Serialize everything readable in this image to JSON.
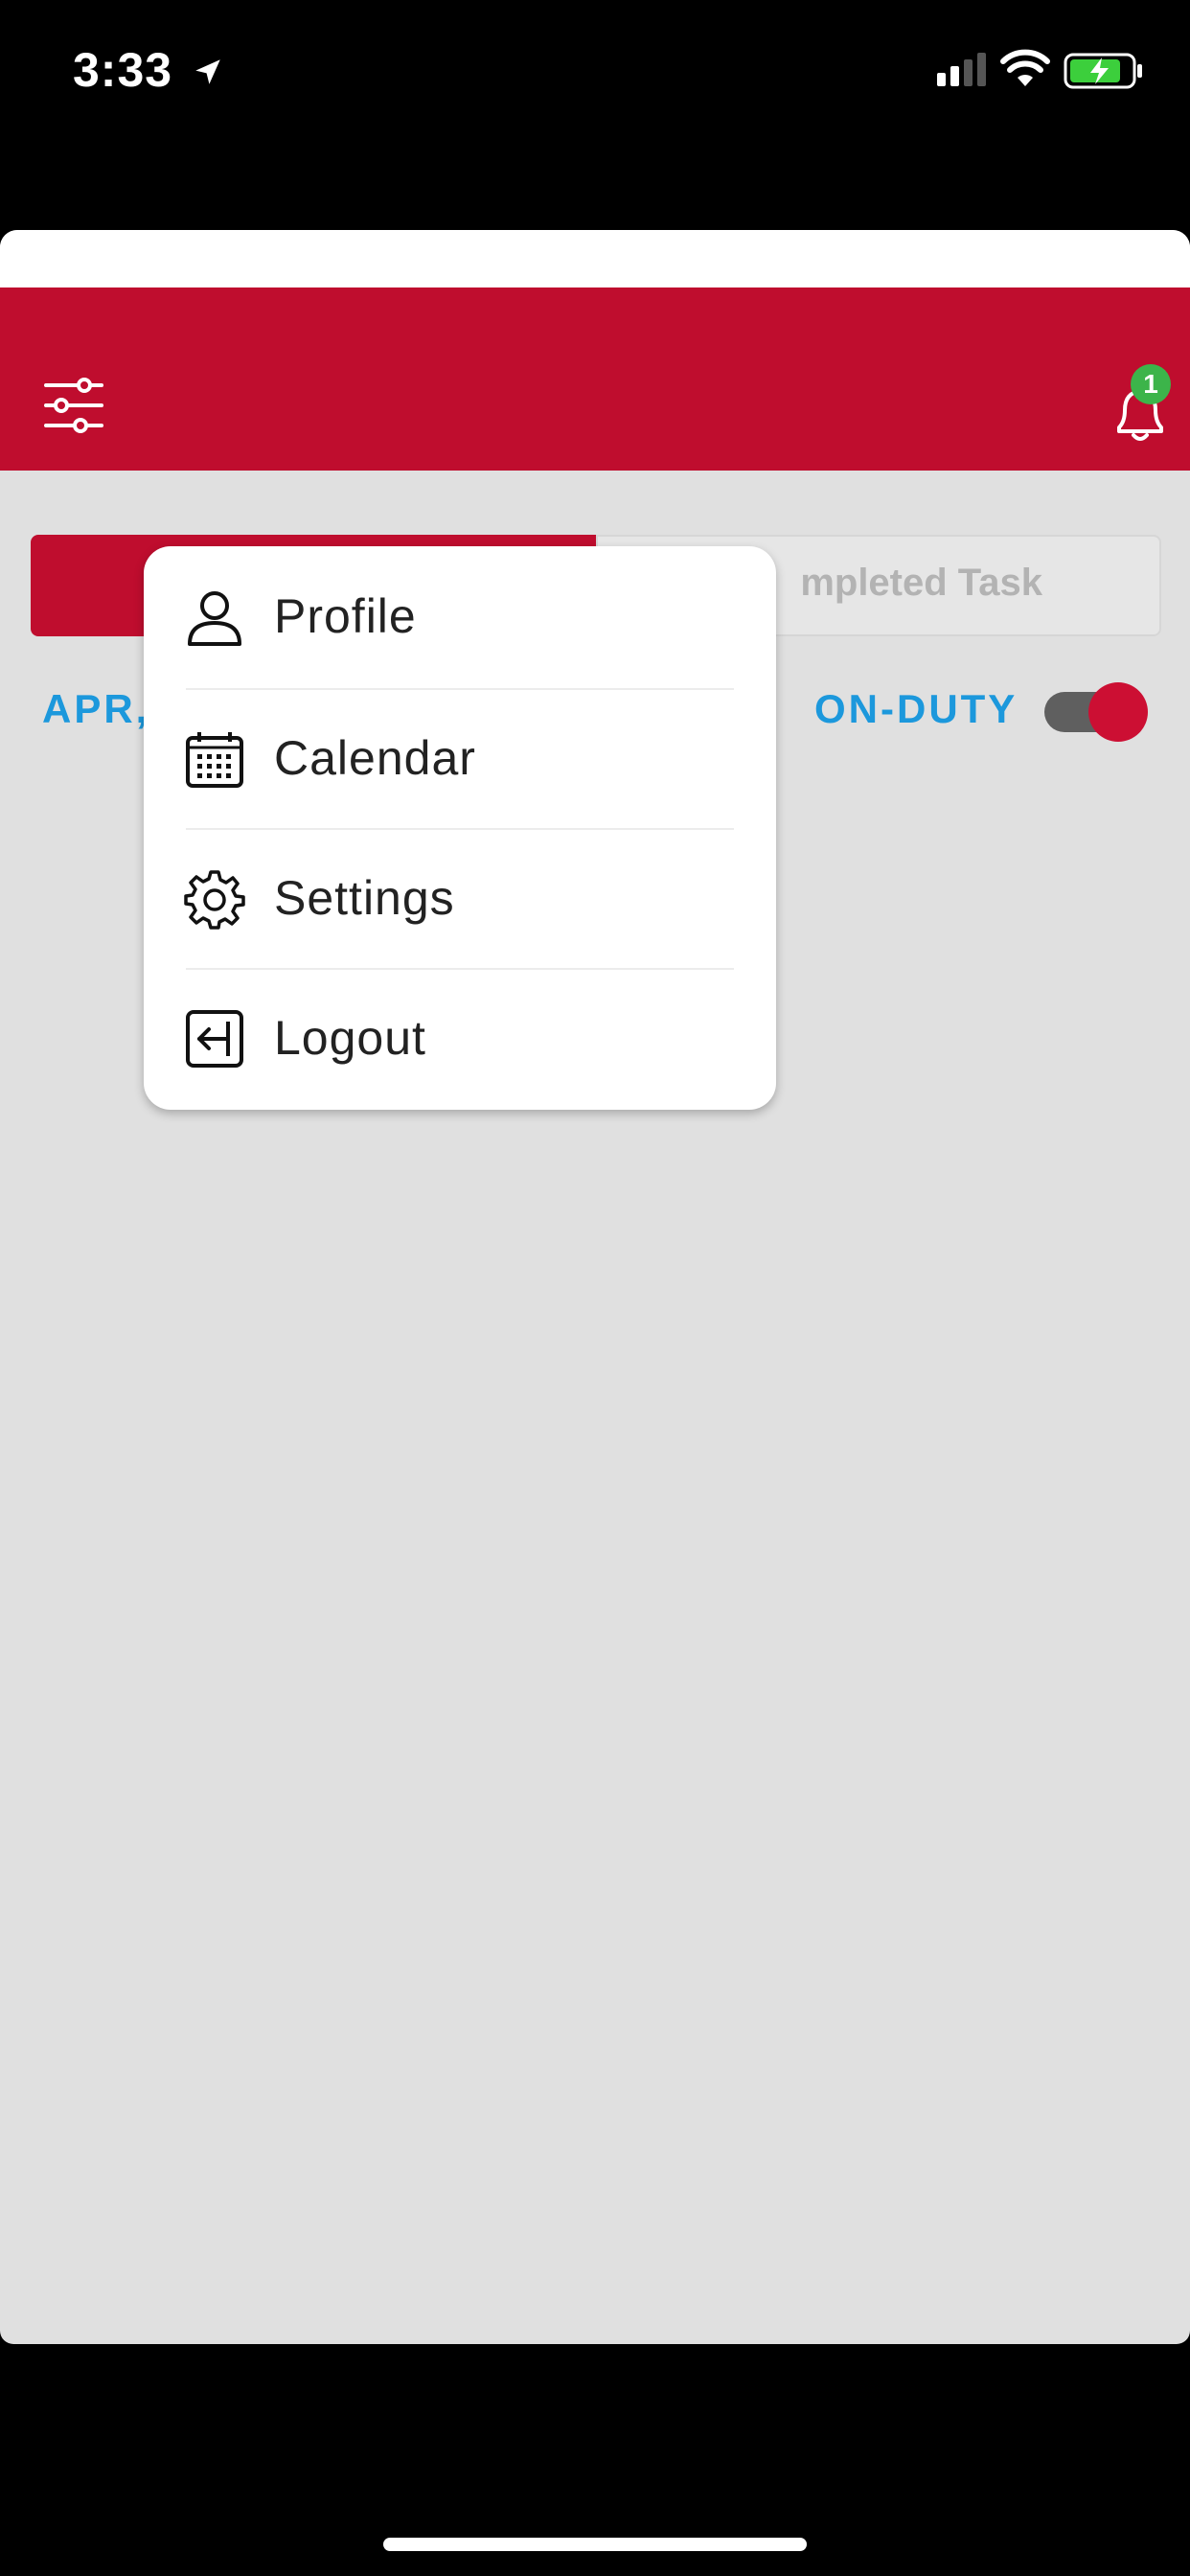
{
  "status_bar": {
    "time": "3:33",
    "icons": [
      "location-arrow-icon",
      "signal-icon",
      "wifi-icon",
      "battery-charging-icon"
    ]
  },
  "header": {
    "filter_icon": "sliders-icon",
    "bell_icon": "bell-icon",
    "notification_count": "1",
    "brand_color": "#bf0d2e"
  },
  "tabs": {
    "active_label": "",
    "inactive_label": "mpleted Task"
  },
  "info_row": {
    "date_label": "APR,",
    "duty_label": "ON-DUTY",
    "duty_toggle_on": true,
    "accent_color": "#1c98dc"
  },
  "menu": {
    "items": [
      {
        "label": "Profile",
        "icon": "user-icon"
      },
      {
        "label": "Calendar",
        "icon": "calendar-icon"
      },
      {
        "label": "Settings",
        "icon": "gear-icon"
      },
      {
        "label": "Logout",
        "icon": "logout-icon"
      }
    ]
  }
}
